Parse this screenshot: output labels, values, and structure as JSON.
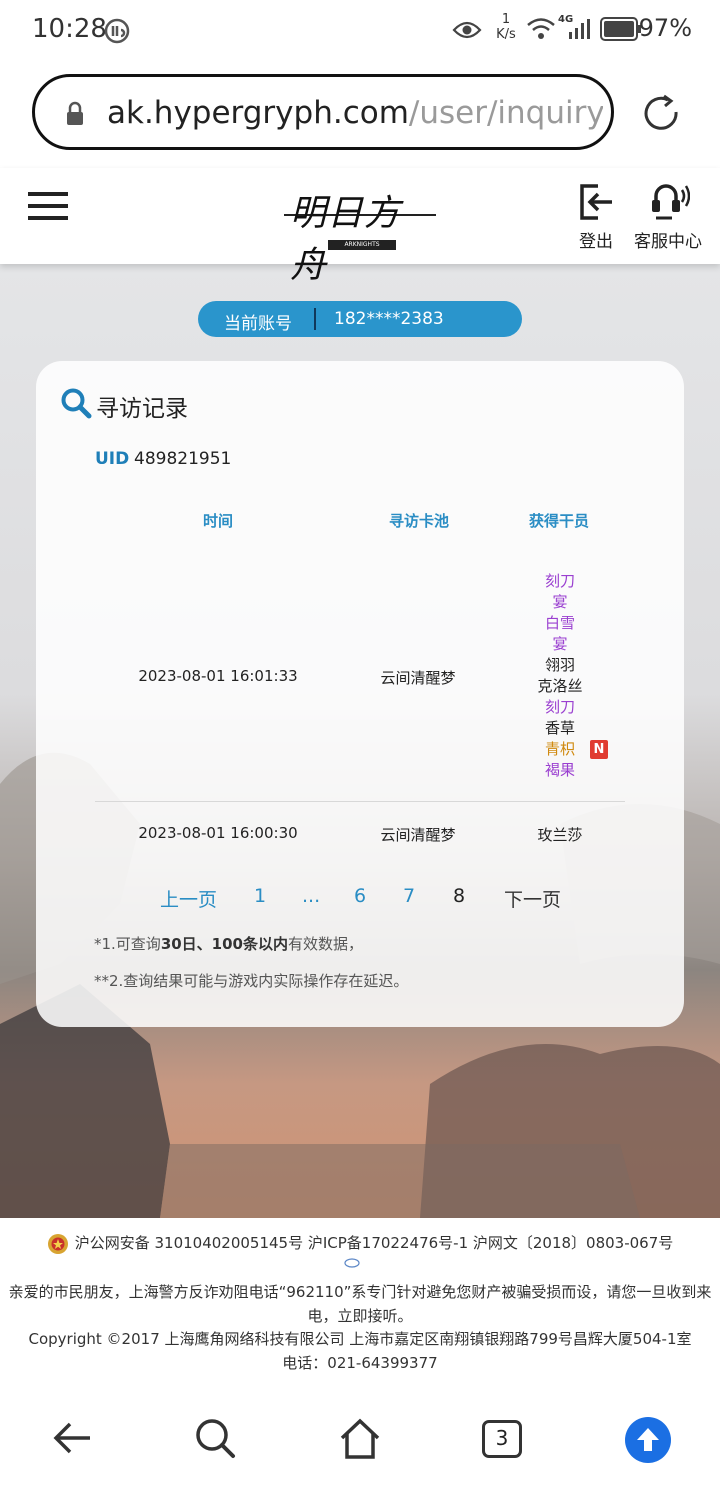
{
  "status": {
    "time": "10:28",
    "speed_value": "1",
    "speed_unit": "K/s",
    "network": "4G",
    "battery": "97%"
  },
  "browser": {
    "url_host": "ak.hypergryph.com",
    "url_path": "/user/inquiryGacha",
    "tab_count": "3"
  },
  "nav": {
    "logout_label": "登出",
    "service_label": "客服中心",
    "logo_text": "明日方舟",
    "logo_sub": "ARKNIGHTS"
  },
  "account": {
    "label": "当前账号",
    "value": "182****2383"
  },
  "card": {
    "title": "寻访记录",
    "uid_label": "UID",
    "uid_value": "489821951",
    "columns": [
      "时间",
      "寻访卡池",
      "获得干员"
    ],
    "rows": [
      {
        "time": "2023-08-01 16:01:33",
        "pool": "云间清醒梦",
        "operators": [
          {
            "name": "刻刀",
            "rarity_color": "#9a3fd0"
          },
          {
            "name": "宴",
            "rarity_color": "#9a3fd0"
          },
          {
            "name": "白雪",
            "rarity_color": "#9a3fd0"
          },
          {
            "name": "宴",
            "rarity_color": "#9a3fd0"
          },
          {
            "name": "翎羽",
            "rarity_color": "#222222"
          },
          {
            "name": "克洛丝",
            "rarity_color": "#222222"
          },
          {
            "name": "刻刀",
            "rarity_color": "#9a3fd0"
          },
          {
            "name": "香草",
            "rarity_color": "#222222"
          },
          {
            "name": "青枳",
            "rarity_color": "#d08a10",
            "new_badge": "N"
          },
          {
            "name": "褐果",
            "rarity_color": "#9a3fd0"
          }
        ]
      },
      {
        "time": "2023-08-01 16:00:30",
        "pool": "云间清醒梦",
        "operators": [
          {
            "name": "玫兰莎",
            "rarity_color": "#222222"
          }
        ]
      }
    ],
    "pagination": {
      "prev": "上一页",
      "pages": [
        "1",
        "...",
        "6",
        "7",
        "8"
      ],
      "current": "8",
      "next": "下一页"
    },
    "note1_prefix": "*1.可查询",
    "note1_bold": "30日、100条以内",
    "note1_suffix": "有效数据，",
    "note2": "**2.查询结果可能与游戏内实际操作存在延迟。"
  },
  "footer": {
    "registration": "沪公网安备 31010402005145号 沪ICP备17022476号-1 沪网文〔2018〕0803-067号",
    "notice": "亲爱的市民朋友，上海警方反诈劝阻电话“962110”系专门针对避免您财产被骗受损而设，请您一旦收到来电，立即接听。",
    "copyright": "Copyright ©2017 上海鹰角网络科技有限公司 上海市嘉定区南翔镇银翔路799号昌辉大厦504-1室",
    "phone": "电话：021-64399377"
  }
}
